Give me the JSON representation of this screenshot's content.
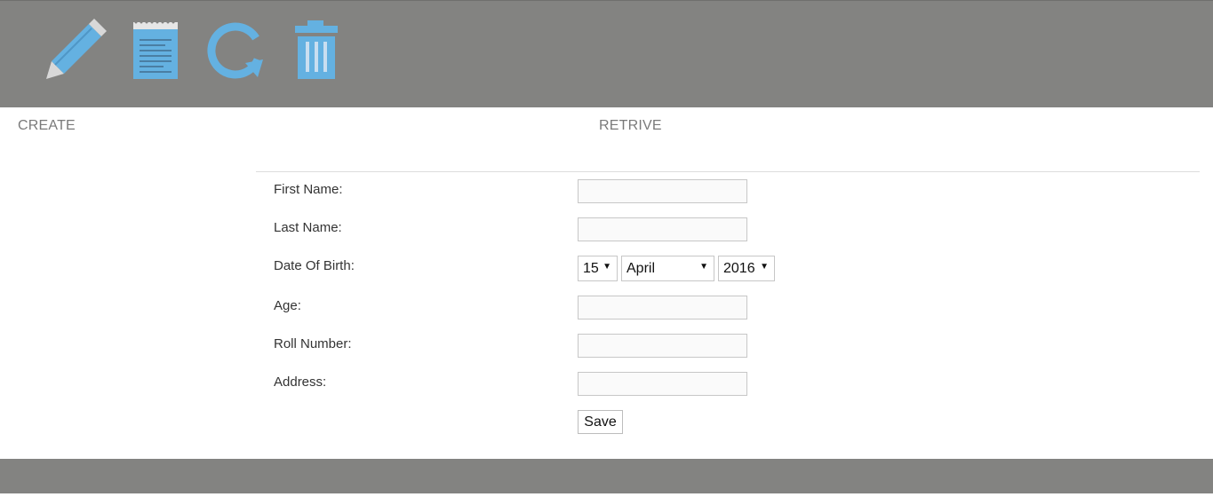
{
  "toolbar": {
    "icons": [
      {
        "name": "pencil-icon",
        "action": "create"
      },
      {
        "name": "notepad-icon",
        "action": "retrieve"
      },
      {
        "name": "refresh-icon",
        "action": "update"
      },
      {
        "name": "trash-icon",
        "action": "delete"
      }
    ],
    "background_color": "#838381",
    "icon_color": "#64b1e1"
  },
  "nav": {
    "create_label": "CREATE",
    "retrieve_label": "RETRIVE"
  },
  "form": {
    "fields": [
      {
        "label": "First Name:",
        "value": ""
      },
      {
        "label": "Last Name:",
        "value": ""
      },
      {
        "label": "Date Of Birth:"
      },
      {
        "label": "Age:",
        "value": ""
      },
      {
        "label": "Roll Number:",
        "value": ""
      },
      {
        "label": "Address:",
        "value": ""
      }
    ],
    "dob": {
      "day": "15",
      "month": "April",
      "year": "2016"
    },
    "save_label": "Save"
  },
  "footer": {
    "background_color": "#838381"
  }
}
